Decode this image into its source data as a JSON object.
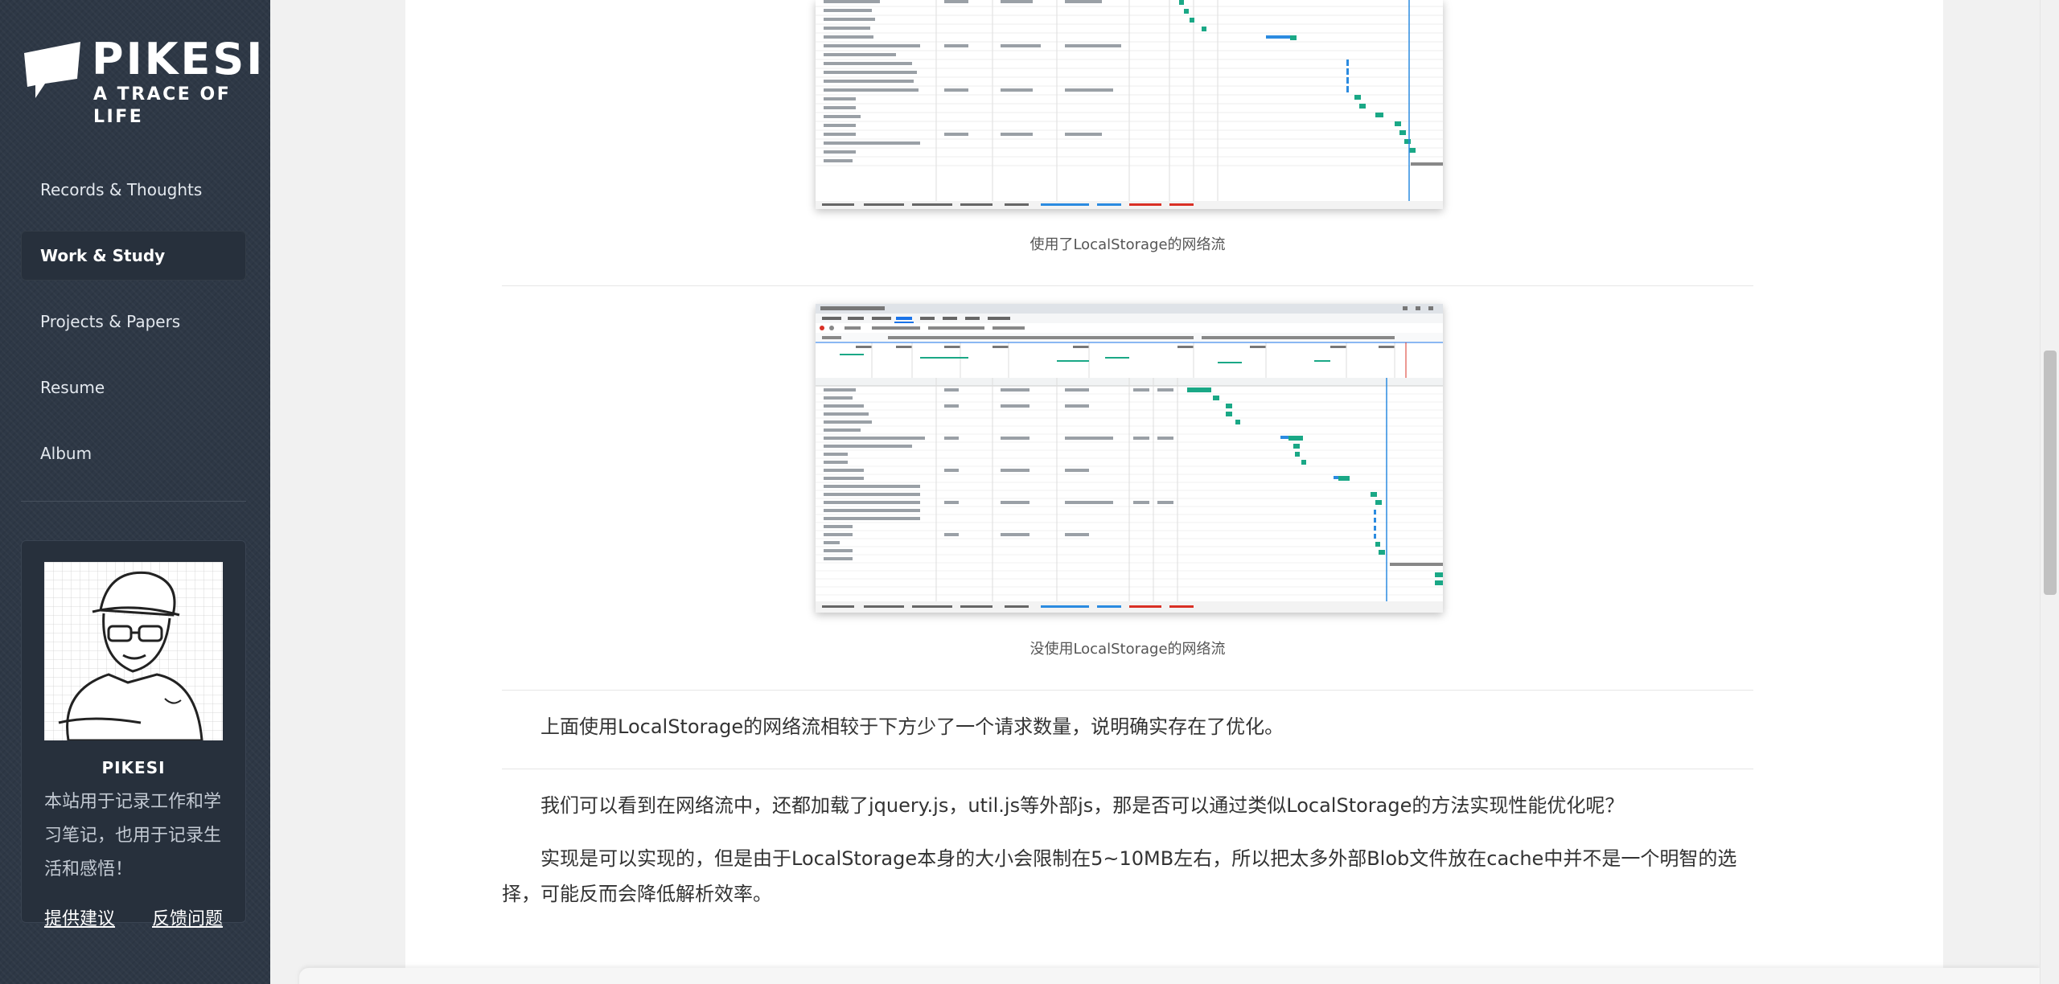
{
  "site": {
    "title": "PIKESI",
    "subtitle": "A TRACE OF LIFE"
  },
  "nav": {
    "items": [
      {
        "label": "Records & Thoughts",
        "active": false
      },
      {
        "label": "Work & Study",
        "active": true
      },
      {
        "label": "Projects & Papers",
        "active": false
      },
      {
        "label": "Resume",
        "active": false
      },
      {
        "label": "Album",
        "active": false
      }
    ]
  },
  "profile": {
    "name": "PIKESI",
    "bio": "本站用于记录工作和学习笔记，也用于记录生活和感悟！",
    "suggest_link": "提供建议",
    "feedback_link": "反馈问题"
  },
  "article": {
    "figure1_caption": "使用了LocalStorage的网络流",
    "figure2_caption": "没使用LocalStorage的网络流",
    "para1": "上面使用LocalStorage的网络流相较于下方少了一个请求数量，说明确实存在了优化。",
    "para2": "我们可以看到在网络流中，还都加载了jquery.js，util.js等外部js，那是否可以通过类似LocalStorage的方法实现性能优化呢？",
    "para3": "实现是可以实现的，但是由于LocalStorage本身的大小会限制在5~10MB左右，所以把太多外部Blob文件放在cache中并不是一个明智的选择，可能反而会降低解析效率。"
  },
  "colors": {
    "sidebar_bg": "#2e3846",
    "nav_active_bg": "#27303c",
    "waterfall_green": "#1aa886",
    "waterfall_blue": "#2b8be0"
  }
}
